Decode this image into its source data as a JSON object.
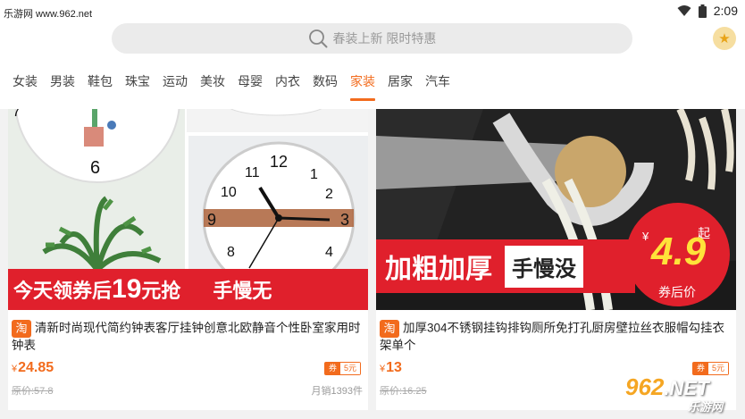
{
  "statusbar": {
    "watermark": "乐游网 www.962.net",
    "time": "2:09"
  },
  "search": {
    "placeholder": "春装上新 限时特惠"
  },
  "tabs": [
    {
      "label": "女装"
    },
    {
      "label": "男装"
    },
    {
      "label": "鞋包"
    },
    {
      "label": "珠宝"
    },
    {
      "label": "运动"
    },
    {
      "label": "美妆"
    },
    {
      "label": "母婴"
    },
    {
      "label": "内衣"
    },
    {
      "label": "数码"
    },
    {
      "label": "家装"
    },
    {
      "label": "居家"
    },
    {
      "label": "汽车"
    }
  ],
  "active_tab": "家装",
  "accent_color": "#f26b1d",
  "products": [
    {
      "banner_text": "今天领券后",
      "banner_amount": "19",
      "banner_unit": "元抢",
      "banner_tag": "手慢无",
      "tag": "淘",
      "title": "清新时尚现代简约钟表客厅挂钟创意北欧静音个性卧室家用时钟表",
      "currency": "¥",
      "price": "24.85",
      "coupon_label": "券",
      "coupon_value": "5元",
      "original_price": "原价:57.8",
      "sales": "月销1393件"
    },
    {
      "banner_text": "加粗加厚",
      "banner_tag": "手慢没",
      "badge_price": "4.9",
      "badge_from": "起",
      "badge_note": "券后价",
      "tag": "淘",
      "title": "加厚304不锈钢挂钩排钩厕所免打孔厨房壁拉丝衣服帽勾挂衣架单个",
      "currency": "¥",
      "price": "13",
      "coupon_label": "券",
      "coupon_value": "5元",
      "original_price": "原价:16.25",
      "sales": ""
    }
  ],
  "watermark_logo": {
    "number": "962",
    "suffix": ".NET",
    "subtitle": "乐游网"
  }
}
